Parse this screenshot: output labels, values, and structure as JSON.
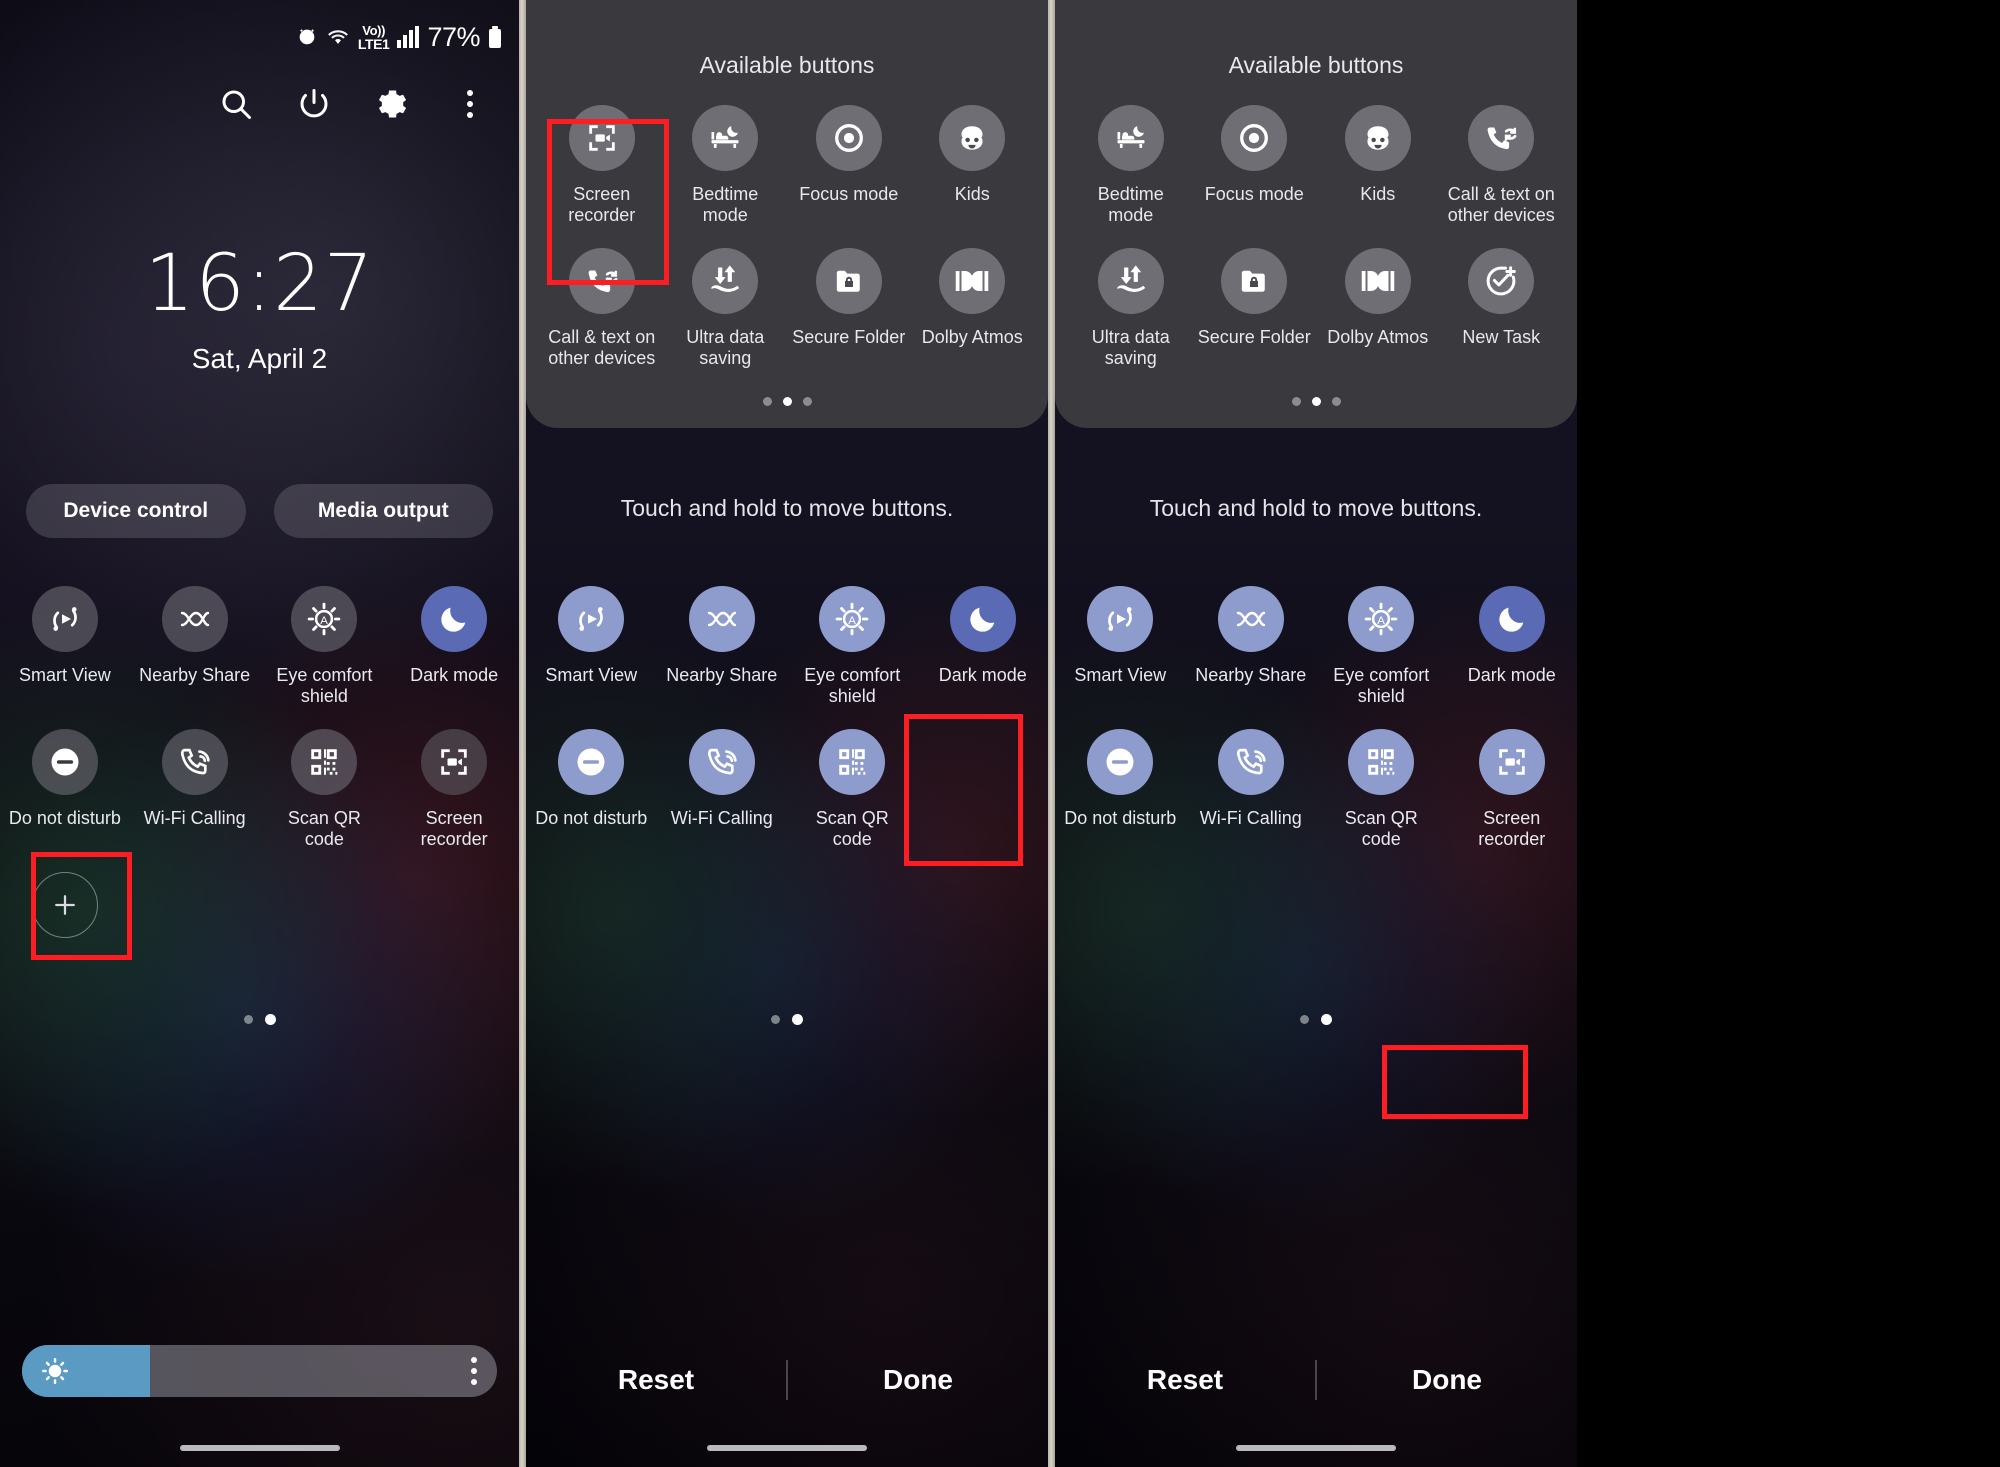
{
  "status_bar": {
    "battery_percent": "77%",
    "network_label_top": "Vo))",
    "network_label_bottom": "LTE1",
    "icons": [
      "alarm-icon",
      "wifi-icon",
      "volte-icon",
      "signal-bars-icon",
      "battery-icon"
    ]
  },
  "header_actions": [
    {
      "name": "search-icon",
      "label": "Search"
    },
    {
      "name": "power-icon",
      "label": "Power off"
    },
    {
      "name": "settings-gear-icon",
      "label": "Settings"
    },
    {
      "name": "more-options-icon",
      "label": "More options"
    }
  ],
  "lockscreen": {
    "time": "16:27",
    "date": "Sat, April 2"
  },
  "pills": [
    {
      "label": "Device control"
    },
    {
      "label": "Media output"
    }
  ],
  "panel1": {
    "toggles_row1": [
      {
        "label": "Smart View",
        "icon": "smart-view-icon",
        "state": "off"
      },
      {
        "label": "Nearby Share",
        "icon": "nearby-share-icon",
        "state": "off"
      },
      {
        "label": "Eye comfort shield",
        "icon": "eye-comfort-icon",
        "state": "off"
      },
      {
        "label": "Dark mode",
        "icon": "moon-icon",
        "state": "on"
      }
    ],
    "toggles_row2": [
      {
        "label": "Do not disturb",
        "icon": "do-not-disturb-icon",
        "state": "off"
      },
      {
        "label": "Wi-Fi Calling",
        "icon": "wifi-calling-icon",
        "state": "off"
      },
      {
        "label": "Scan QR code",
        "icon": "qr-code-icon",
        "state": "off"
      },
      {
        "label": "Screen recorder",
        "icon": "screen-recorder-icon",
        "state": "off"
      }
    ],
    "add_button": {
      "label": "",
      "icon": "plus-icon"
    },
    "page_dots": {
      "count": 2,
      "active_index": 1
    },
    "brightness": {
      "percent": 27,
      "icon": "brightness-sun-icon",
      "menu_icon": "vertical-dots-icon"
    }
  },
  "panel2": {
    "tray_title": "Available buttons",
    "tray_buttons": [
      {
        "label": "Screen recorder",
        "icon": "screen-recorder-icon"
      },
      {
        "label": "Bedtime mode",
        "icon": "bedtime-mode-icon"
      },
      {
        "label": "Focus mode",
        "icon": "focus-mode-icon"
      },
      {
        "label": "Kids",
        "icon": "kids-icon"
      },
      {
        "label": "Call & text on other devices",
        "icon": "call-text-other-devices-icon"
      },
      {
        "label": "Ultra data saving",
        "icon": "ultra-data-saving-icon"
      },
      {
        "label": "Secure Folder",
        "icon": "secure-folder-icon"
      },
      {
        "label": "Dolby Atmos",
        "icon": "dolby-atmos-icon"
      }
    ],
    "tray_dots": {
      "count": 3,
      "active_index": 1
    },
    "hint": "Touch and hold to move buttons.",
    "toggles_row1": [
      {
        "label": "Smart View",
        "icon": "smart-view-icon"
      },
      {
        "label": "Nearby Share",
        "icon": "nearby-share-icon"
      },
      {
        "label": "Eye comfort shield",
        "icon": "eye-comfort-icon"
      },
      {
        "label": "Dark mode",
        "icon": "moon-icon"
      }
    ],
    "toggles_row2": [
      {
        "label": "Do not disturb",
        "icon": "do-not-disturb-icon"
      },
      {
        "label": "Wi-Fi Calling",
        "icon": "wifi-calling-icon"
      },
      {
        "label": "Scan QR code",
        "icon": "qr-code-icon"
      },
      {
        "label": "",
        "icon": "empty-slot"
      }
    ],
    "page_dots": {
      "count": 2,
      "active_index": 1
    },
    "buttons": {
      "reset": "Reset",
      "done": "Done"
    }
  },
  "panel3": {
    "tray_title": "Available buttons",
    "tray_buttons": [
      {
        "label": "Bedtime mode",
        "icon": "bedtime-mode-icon"
      },
      {
        "label": "Focus mode",
        "icon": "focus-mode-icon"
      },
      {
        "label": "Kids",
        "icon": "kids-icon"
      },
      {
        "label": "Call & text on other devices",
        "icon": "call-text-other-devices-icon"
      },
      {
        "label": "Ultra data saving",
        "icon": "ultra-data-saving-icon"
      },
      {
        "label": "Secure Folder",
        "icon": "secure-folder-icon"
      },
      {
        "label": "Dolby Atmos",
        "icon": "dolby-atmos-icon"
      },
      {
        "label": "New Task",
        "icon": "new-task-icon"
      }
    ],
    "tray_dots": {
      "count": 3,
      "active_index": 1
    },
    "hint": "Touch and hold to move buttons.",
    "toggles_row1": [
      {
        "label": "Smart View",
        "icon": "smart-view-icon"
      },
      {
        "label": "Nearby Share",
        "icon": "nearby-share-icon"
      },
      {
        "label": "Eye comfort shield",
        "icon": "eye-comfort-icon"
      },
      {
        "label": "Dark mode",
        "icon": "moon-icon"
      }
    ],
    "toggles_row2": [
      {
        "label": "Do not disturb",
        "icon": "do-not-disturb-icon"
      },
      {
        "label": "Wi-Fi Calling",
        "icon": "wifi-calling-icon"
      },
      {
        "label": "Scan QR code",
        "icon": "qr-code-icon"
      },
      {
        "label": "Screen recorder",
        "icon": "screen-recorder-icon"
      }
    ],
    "page_dots": {
      "count": 2,
      "active_index": 1
    },
    "buttons": {
      "reset": "Reset",
      "done": "Done"
    }
  },
  "colors": {
    "highlight": "#ff1d24",
    "tray_bg": "#3a393e",
    "toggle_on": "#5a6ab4",
    "toggle_lavender": "#8e9ccd",
    "brightness_fill": "#5b9ac2"
  }
}
